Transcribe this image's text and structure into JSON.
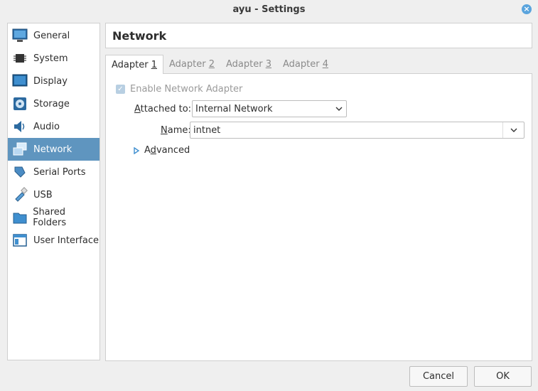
{
  "window": {
    "title": "ayu - Settings"
  },
  "sidebar": {
    "items": [
      {
        "label": "General",
        "icon": "monitor-general-icon"
      },
      {
        "label": "System",
        "icon": "chip-icon"
      },
      {
        "label": "Display",
        "icon": "display-icon"
      },
      {
        "label": "Storage",
        "icon": "disc-icon"
      },
      {
        "label": "Audio",
        "icon": "speaker-icon"
      },
      {
        "label": "Network",
        "icon": "network-icon"
      },
      {
        "label": "Serial Ports",
        "icon": "serial-port-icon"
      },
      {
        "label": "USB",
        "icon": "usb-icon"
      },
      {
        "label": "Shared Folders",
        "icon": "folder-icon"
      },
      {
        "label": "User Interface",
        "icon": "window-icon"
      }
    ],
    "active": "Network"
  },
  "page": {
    "title": "Network"
  },
  "tabs": [
    {
      "prefix": "Adapter ",
      "key": "1"
    },
    {
      "prefix": "Adapter ",
      "key": "2"
    },
    {
      "prefix": "Adapter ",
      "key": "3"
    },
    {
      "prefix": "Adapter ",
      "key": "4"
    }
  ],
  "adapter": {
    "enable_label": "Enable Network Adapter",
    "enabled": true,
    "attached_key": "A",
    "attached_rest": "ttached to:",
    "attached_value": "Internal Network",
    "name_key": "N",
    "name_rest": "ame:",
    "name_value": "intnet",
    "advanced_key": "d",
    "advanced_pre": "A",
    "advanced_rest": "vanced"
  },
  "buttons": {
    "cancel": "Cancel",
    "ok": "OK"
  },
  "colors": {
    "active_item": "#5f95bf",
    "close_btn": "#5aa4dd"
  }
}
